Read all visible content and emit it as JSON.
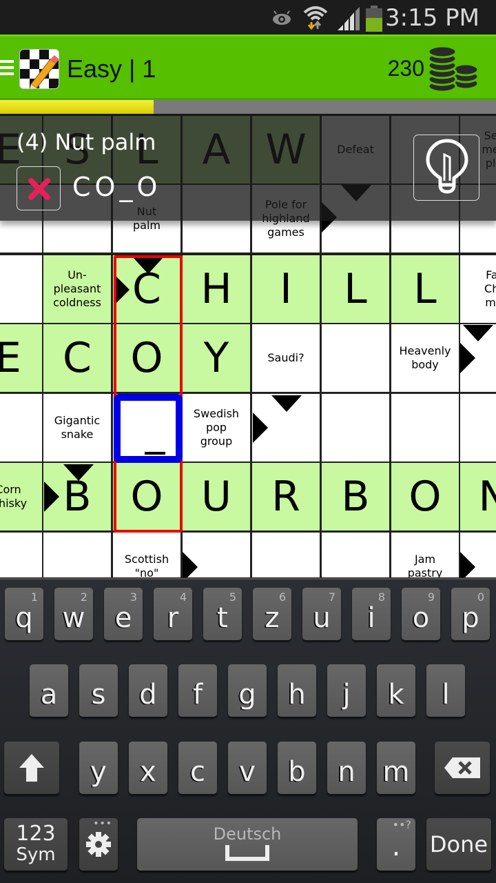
{
  "status_bar": {
    "time": "3:15 PM",
    "icons": [
      "eye-icon",
      "wifi-icon",
      "signal-icon",
      "battery-icon"
    ]
  },
  "app_bar": {
    "title": "Easy | 1",
    "coins": "230",
    "menu_icon": "hamburger-menu-icon",
    "logo_icon": "crossword-pencil-logo",
    "coins_icon": "coin-stack-icon"
  },
  "progress": {
    "fraction": 0.31
  },
  "clue_overlay": {
    "clue": "(4)  Nut palm",
    "answer": "CO_O",
    "clear_icon": "clear-x-icon",
    "hint_icon": "lightbulb-icon"
  },
  "grid": {
    "rows": [
      [
        {
          "type": "green",
          "letter": "E"
        },
        {
          "type": "green",
          "letter": "S"
        },
        {
          "type": "green",
          "letter": "L"
        },
        {
          "type": "green",
          "letter": "A"
        },
        {
          "type": "green",
          "letter": "W"
        },
        {
          "type": "white",
          "clue": "Defeat"
        },
        {
          "type": "white",
          "clue": ""
        },
        {
          "type": "white",
          "clue": "Sec\nmee\npla"
        }
      ],
      [
        {
          "type": "white",
          "clue": ""
        },
        {
          "type": "white",
          "clue": ""
        },
        {
          "type": "white",
          "clue": "Nut\npalm"
        },
        {
          "type": "white",
          "clue": ""
        },
        {
          "type": "white",
          "clue": "Pole for\nhighland\ngames"
        },
        {
          "type": "white",
          "clue": ""
        },
        {
          "type": "white",
          "clue": ""
        },
        {
          "type": "white",
          "clue": ""
        }
      ],
      [
        {
          "type": "white",
          "clue": ""
        },
        {
          "type": "green",
          "clue": "Un-\npleasant\ncoldness"
        },
        {
          "type": "green",
          "letter": "C"
        },
        {
          "type": "green",
          "letter": "H"
        },
        {
          "type": "green",
          "letter": "I"
        },
        {
          "type": "green",
          "letter": "L"
        },
        {
          "type": "green",
          "letter": "L"
        },
        {
          "type": "white",
          "clue": "Fat\nChr\nma"
        }
      ],
      [
        {
          "type": "green",
          "letter": "E"
        },
        {
          "type": "green",
          "letter": "C"
        },
        {
          "type": "green",
          "letter": "O"
        },
        {
          "type": "green",
          "letter": "Y"
        },
        {
          "type": "white",
          "clue": "Saudi?"
        },
        {
          "type": "white",
          "clue": ""
        },
        {
          "type": "white",
          "clue": "Heavenly\nbody"
        },
        {
          "type": "white",
          "clue": ""
        }
      ],
      [
        {
          "type": "white",
          "clue": ""
        },
        {
          "type": "white",
          "clue": "Gigantic\nsnake"
        },
        {
          "type": "white",
          "letter": ""
        },
        {
          "type": "white",
          "clue": "Swedish\npop\ngroup"
        },
        {
          "type": "white",
          "clue": ""
        },
        {
          "type": "white",
          "clue": ""
        },
        {
          "type": "white",
          "clue": ""
        },
        {
          "type": "white",
          "clue": ""
        }
      ],
      [
        {
          "type": "green",
          "clue": "Corn\nwhisky"
        },
        {
          "type": "green",
          "letter": "B"
        },
        {
          "type": "green",
          "letter": "O"
        },
        {
          "type": "green",
          "letter": "U"
        },
        {
          "type": "green",
          "letter": "R"
        },
        {
          "type": "green",
          "letter": "B"
        },
        {
          "type": "green",
          "letter": "O"
        },
        {
          "type": "green",
          "letter": "N"
        }
      ],
      [
        {
          "type": "white",
          "clue": ""
        },
        {
          "type": "white",
          "clue": ""
        },
        {
          "type": "white",
          "clue": "Scottish\n\"no\""
        },
        {
          "type": "white",
          "clue": ""
        },
        {
          "type": "white",
          "clue": ""
        },
        {
          "type": "white",
          "clue": ""
        },
        {
          "type": "white",
          "clue": "Jam\npastry"
        },
        {
          "type": "white",
          "clue": ""
        }
      ]
    ]
  },
  "keyboard": {
    "row1": [
      {
        "k": "q",
        "n": "1"
      },
      {
        "k": "w",
        "n": "2"
      },
      {
        "k": "e",
        "n": "3"
      },
      {
        "k": "r",
        "n": "4"
      },
      {
        "k": "t",
        "n": "5"
      },
      {
        "k": "z",
        "n": "6"
      },
      {
        "k": "u",
        "n": "7"
      },
      {
        "k": "i",
        "n": "8"
      },
      {
        "k": "o",
        "n": "9"
      },
      {
        "k": "p",
        "n": "0"
      }
    ],
    "row2": [
      "a",
      "s",
      "d",
      "f",
      "g",
      "h",
      "j",
      "k",
      "l"
    ],
    "row3": [
      "y",
      "x",
      "c",
      "v",
      "b",
      "n",
      "m"
    ],
    "sym_label_1": "123",
    "sym_label_2": "Sym",
    "space_label": "Deutsch",
    "period_label": ".",
    "period_alt": "••?",
    "done_label": "Done",
    "shift_icon": "shift-arrow-icon",
    "backspace_icon": "backspace-icon",
    "settings_icon": "gear-icon",
    "space_icon": "spacebar-icon"
  }
}
